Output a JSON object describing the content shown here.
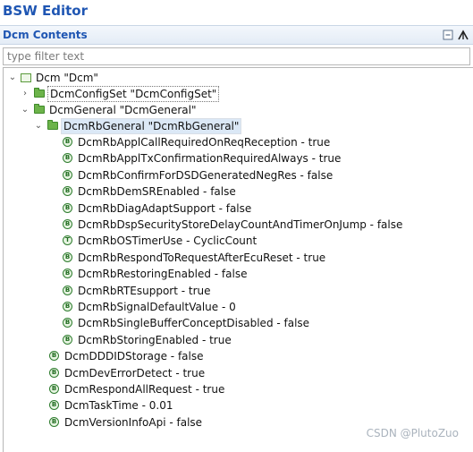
{
  "app": {
    "title": "BSW Editor"
  },
  "panel": {
    "title": "Dcm Contents",
    "collapse_icon": "collapse-all-icon",
    "menu_icon": "view-menu-icon"
  },
  "filter": {
    "placeholder": "type filter text",
    "value": ""
  },
  "tree": {
    "root": {
      "label": "Dcm \"Dcm\"",
      "expanded": true,
      "icon": "module-icon"
    },
    "config_set": {
      "label": "DcmConfigSet \"DcmConfigSet\"",
      "expanded": false,
      "icon": "folder-icon"
    },
    "general": {
      "label": "DcmGeneral \"DcmGeneral\"",
      "expanded": true,
      "icon": "folder-icon"
    },
    "rb_general": {
      "label": "DcmRbGeneral \"DcmRbGeneral\"",
      "expanded": true,
      "icon": "folder-icon",
      "selected": true
    },
    "rb_params": [
      {
        "label": "DcmRbApplCallRequiredOnReqReception - true",
        "icon_glyph": "B"
      },
      {
        "label": "DcmRbApplTxConfirmationRequiredAlways - true",
        "icon_glyph": "B"
      },
      {
        "label": "DcmRbConfirmForDSDGeneratedNegRes - false",
        "icon_glyph": "B"
      },
      {
        "label": "DcmRbDemSREnabled - false",
        "icon_glyph": "B"
      },
      {
        "label": "DcmRbDiagAdaptSupport - false",
        "icon_glyph": "B"
      },
      {
        "label": "DcmRbDspSecurityStoreDelayCountAndTimerOnJump - false",
        "icon_glyph": "B"
      },
      {
        "label": "DcmRbOSTimerUse - CyclicCount",
        "icon_glyph": "T"
      },
      {
        "label": "DcmRbRespondToRequestAfterEcuReset - true",
        "icon_glyph": "B"
      },
      {
        "label": "DcmRbRestoringEnabled - false",
        "icon_glyph": "B"
      },
      {
        "label": "DcmRbRTEsupport - true",
        "icon_glyph": "B"
      },
      {
        "label": "DcmRbSignalDefaultValue - 0",
        "icon_glyph": "B"
      },
      {
        "label": "DcmRbSingleBufferConceptDisabled - false",
        "icon_glyph": "B"
      },
      {
        "label": "DcmRbStoringEnabled - true",
        "icon_glyph": "B"
      }
    ],
    "general_params": [
      {
        "label": "DcmDDDIDStorage - false",
        "icon_glyph": "B"
      },
      {
        "label": "DcmDevErrorDetect - true",
        "icon_glyph": "B"
      },
      {
        "label": "DcmRespondAllRequest - true",
        "icon_glyph": "B"
      },
      {
        "label": "DcmTaskTime - 0.01",
        "icon_glyph": "B"
      },
      {
        "label": "DcmVersionInfoApi - false",
        "icon_glyph": "B"
      }
    ]
  },
  "watermark": "CSDN @PlutoZuo",
  "colors": {
    "accent": "#1f56b3",
    "folder_green": "#6cb34a",
    "selection": "#dbe8f6"
  }
}
